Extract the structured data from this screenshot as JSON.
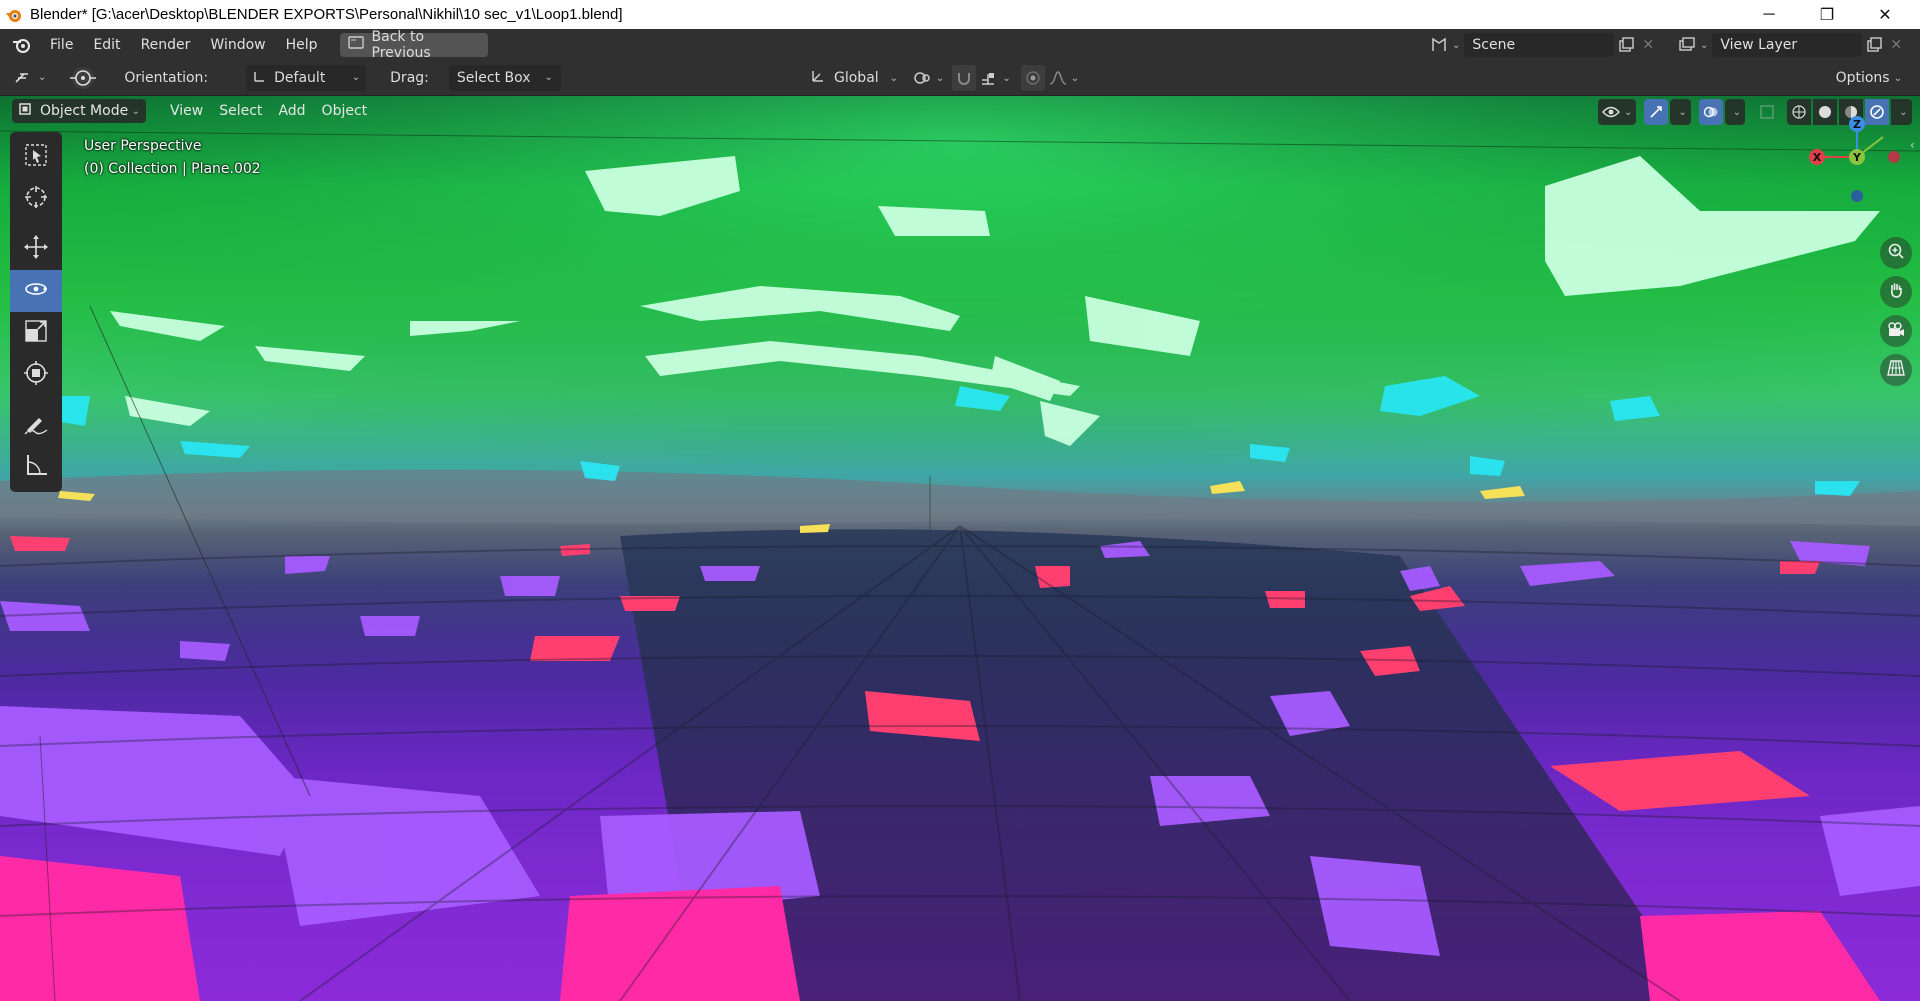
{
  "window": {
    "title": "Blender* [G:\\acer\\Desktop\\BLENDER EXPORTS\\Personal\\Nikhil\\10 sec_v1\\Loop1.blend]",
    "controls": {
      "minimize": "─",
      "maximize": "❐",
      "close": "✕"
    }
  },
  "menubar": {
    "items": [
      "File",
      "Edit",
      "Render",
      "Window",
      "Help"
    ],
    "back_button": "Back to Previous",
    "scene": "Scene",
    "view_layer": "View Layer"
  },
  "tool_header": {
    "orientation_label": "Orientation:",
    "orientation_value": "Default",
    "drag_label": "Drag:",
    "drag_value": "Select Box",
    "transform_orientation": "Global",
    "options": "Options"
  },
  "viewport_header": {
    "mode": "Object Mode",
    "menus": [
      "View",
      "Select",
      "Add",
      "Object"
    ]
  },
  "viewport": {
    "perspective": "User Perspective",
    "collection": "(0) Collection | Plane.002"
  },
  "gizmo": {
    "x": "X",
    "y": "Y",
    "z": "Z"
  },
  "colors": {
    "accent": "#4772b3",
    "header": "#303030",
    "x_axis": "#e0404a",
    "y_axis": "#8bc53f",
    "z_axis": "#3b8ee8"
  },
  "toolbar": {
    "tools": [
      "select-box-icon",
      "cursor-icon",
      "move-icon",
      "rotate-icon",
      "scale-icon",
      "transform-icon",
      "annotate-icon",
      "measure-icon"
    ],
    "active_tool": "rotate-icon"
  }
}
